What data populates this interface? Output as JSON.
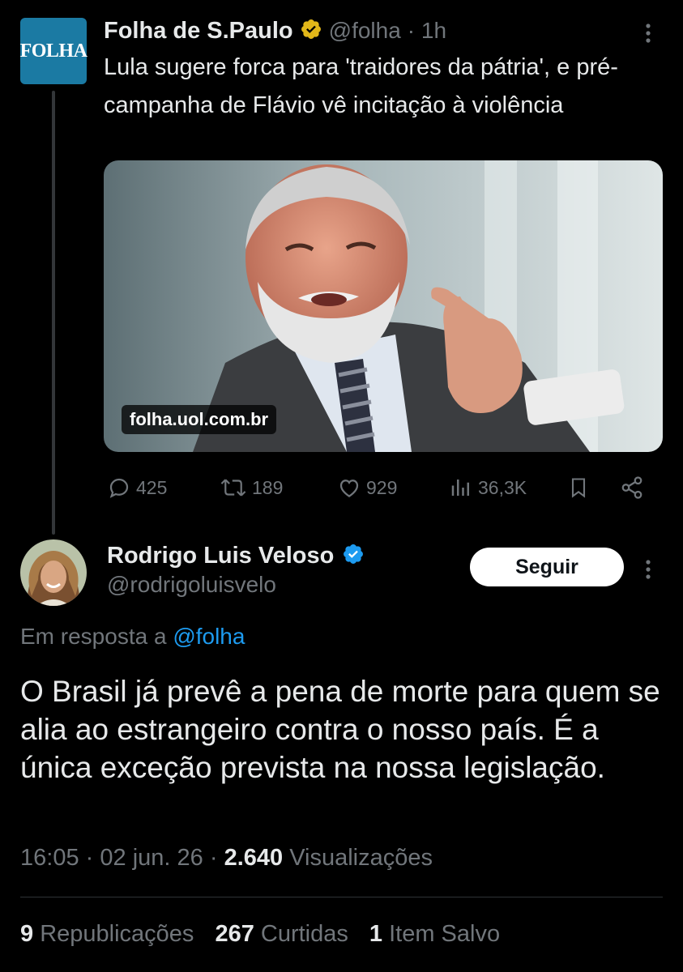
{
  "parent_tweet": {
    "avatar_text": "FOLHA",
    "author_name": "Folha de S.Paulo",
    "handle": "@folha",
    "time": "· 1h",
    "text": "Lula sugere forca para 'traidores da pátria', e pré-campanha de Flávio vê incitação à violência",
    "link_domain": "folha.uol.com.br",
    "actions": {
      "replies": "425",
      "retweets": "189",
      "likes": "929",
      "views": "36,3K"
    },
    "icons": [
      "gold-verified-badge-icon",
      "more-icon",
      "reply-icon",
      "retweet-icon",
      "like-icon",
      "views-icon",
      "bookmark-icon",
      "share-icon"
    ]
  },
  "reply_tweet": {
    "author_name": "Rodrigo Luis Veloso",
    "handle": "@rodrigoluisvelo",
    "follow_label": "Seguir",
    "reply_prefix": "Em resposta a",
    "reply_handle": "@folha",
    "text": "O Brasil já prevê a pena de morte para quem se alia ao estrangeiro contra o nosso país. É a única exceção prevista na nossa legislação.",
    "time": "16:05",
    "date": "02 jun. 26",
    "views_count": "2.640",
    "views_label": "Visualizações",
    "stats": {
      "reposts_count": "9",
      "reposts_label": "Republicações",
      "likes_count": "267",
      "likes_label": "Curtidas",
      "saved_count": "1",
      "saved_label": "Item Salvo"
    }
  },
  "colors": {
    "background": "#000000",
    "text_primary": "#e7e9ea",
    "text_secondary": "#71767b",
    "link_blue": "#1d9bf0",
    "verified_gold": "#e2b719",
    "verified_blue": "#1d9bf0",
    "folha_blue": "#1b7aa3"
  }
}
